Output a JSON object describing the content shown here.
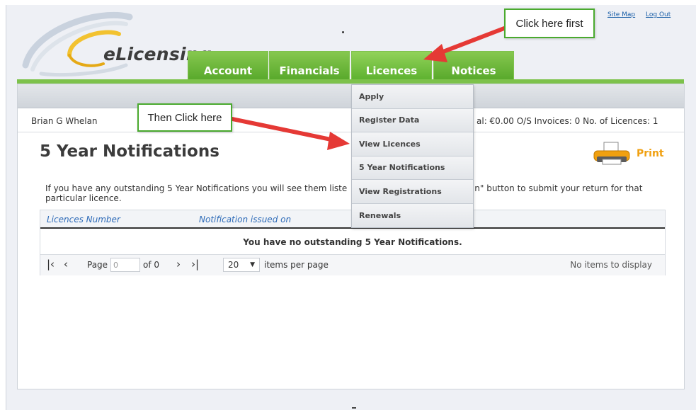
{
  "header": {
    "logo_text": "eLicensing",
    "top_links": [
      "Site Map",
      "Log Out"
    ]
  },
  "nav": {
    "tabs": [
      "Account",
      "Financials",
      "Licences",
      "Notices"
    ],
    "active_tab": "Licences",
    "accent_color": "#6ab83a"
  },
  "licences_menu": {
    "items": [
      "Apply",
      "Register Data",
      "View Licences",
      "5 Year Notifications",
      "View Registrations",
      "Renewals"
    ]
  },
  "user_bar": {
    "name": "Brian G Whelan",
    "stats": "al: €0.00   O/S Invoices: 0   No. of Licences: 1"
  },
  "page": {
    "title": "5 Year Notifications",
    "print_label": "Print",
    "intro_before": "If you have any outstanding 5 Year Notifications you will see them liste",
    "intro_after": "n\" button to submit your return for that particular licence."
  },
  "grid": {
    "columns": [
      "Licences Number",
      "Notification issued on"
    ],
    "empty_message": "You have no outstanding 5 Year Notifications.",
    "pager": {
      "page_label": "Page",
      "page_value": "0",
      "of_label": "of 0",
      "per_page_value": "20",
      "per_page_label": "items per page",
      "status": "No items to display"
    }
  },
  "annotations": {
    "first": "Click here first",
    "then": "Then Click here",
    "arrow_color": "#e53935",
    "border_color": "#4aaa2e"
  }
}
